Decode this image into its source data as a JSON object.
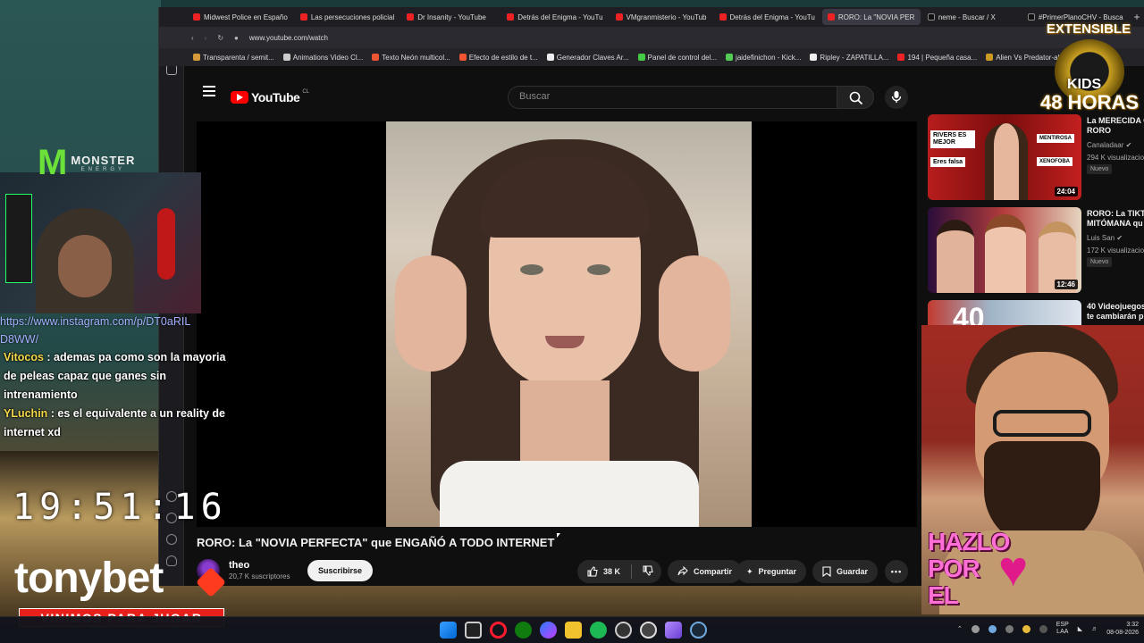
{
  "tabs": [
    {
      "label": "Midwest Police en Españo",
      "active": false
    },
    {
      "label": "Las persecuciones policial",
      "active": false
    },
    {
      "label": "Dr Insanity - YouTube",
      "active": false
    },
    {
      "label": "Detrás del Enigma - YouTu",
      "active": false
    },
    {
      "label": "VMgranmisterio - YouTub",
      "active": false
    },
    {
      "label": "Detrás del Enigma - YouTu",
      "active": false
    },
    {
      "label": "RORO: La \"NOVIA PER",
      "active": true
    },
    {
      "label": "neme - Buscar / X",
      "active": false
    },
    {
      "label": "#PrimerPlanoCHV - Busca",
      "active": false
    }
  ],
  "address": {
    "url": "www.youtube.com/watch"
  },
  "bookmarks": [
    "Transparenta / semit...",
    "Animations Video Cl...",
    "Texto Neón multicol...",
    "Efecto de estilo de t...",
    "Generador Claves Ar...",
    "Panel de control del...",
    "jaidefinichon - Kick...",
    "Ripley - ZAPATILLA...",
    "194 | Pequeña casa...",
    "Alien Vs Predator-alf...",
    "cre"
  ],
  "youtube": {
    "logo_text": "YouTube",
    "country_code": "CL",
    "search_placeholder": "Buscar",
    "video_title": "RORO: La \"NOVIA PERFECTA\" que ENGAÑÓ A TODO INTERNET",
    "channel_name": "theo",
    "channel_subs": "20,7 K suscriptores",
    "subscribe_label": "Suscribirse",
    "likes": "38 K",
    "share_label": "Compartir",
    "ask_label": "Preguntar",
    "save_label": "Guardar"
  },
  "recommended": [
    {
      "title": "La MERECIDA C ROR O",
      "title_line1": "La MERECIDA C",
      "title_line2": "RORO",
      "channel": "Canaladaar",
      "views": "294 K visualizacio",
      "badge": "Nuevo",
      "duration": "24:04",
      "thumb_labels": [
        "RIVERS ES MEJOR",
        "MENTIROSA",
        "Eres falsa",
        "XENOFOBA"
      ]
    },
    {
      "title_line1": "RORO: La TIKT",
      "title_line2": "MITÓMANA qu",
      "channel": "Luis San",
      "views": "172 K visualizacio",
      "badge": "Nuevo",
      "duration": "12:46",
      "thumb_labels": []
    },
    {
      "title_line1": "40 Videojuegos",
      "title_line2": "te cambiarán p",
      "channel": "",
      "views": "",
      "badge": "",
      "duration": "",
      "thumb_labels": [
        "40"
      ]
    }
  ],
  "overlay": {
    "monster_brand": "MONSTER",
    "monster_sub": "ENERGY",
    "chat_link_line1": "https://www.instagram.com/p/DT0aRIL",
    "chat_link_line2": "D8WW/",
    "chat": [
      {
        "user": "Vitocos",
        "text": " : ademas pa como son la mayoria de peleas capaz que ganes sin intrenamiento"
      },
      {
        "user": "YLuchin",
        "text": " : es el equivalente a un reality de internet xd"
      }
    ],
    "clock": "19:51:16",
    "sponsor": "tonybet",
    "sponsor_tagline": "VINIMOS PARA JUGAR",
    "kids_top": "EXTENSIBLE",
    "kids_mid": "KIDS",
    "kids_bottom": "48 HORAS",
    "hazlo_lines": [
      "HAZLO",
      "POR",
      "EL"
    ]
  },
  "taskbar": {
    "lang_line1": "ESP",
    "lang_line2": "LAA",
    "time": "3:32",
    "date": "08-08-2026"
  },
  "colors": {
    "yt_red": "#ff0000",
    "chat_user": "#f2d84a",
    "link": "#a3b0ff",
    "sponsor_red": "#e8201c"
  }
}
